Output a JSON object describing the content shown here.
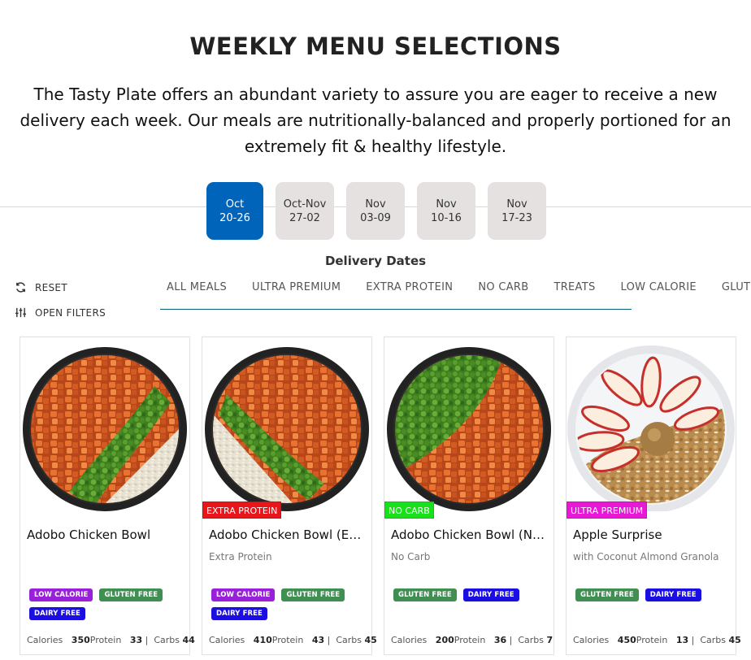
{
  "header": {
    "title": "WEEKLY MENU SELECTIONS",
    "intro": "The Tasty Plate offers an abundant variety to assure you are eager to receive a new delivery each week. Our meals are nutritionally-balanced and properly portioned for an extremely fit & healthy lifestyle."
  },
  "dates": [
    {
      "month": "Oct",
      "range": "20-26",
      "active": true
    },
    {
      "month": "Oct-Nov",
      "range": "27-02",
      "active": false
    },
    {
      "month": "Nov",
      "range": "03-09",
      "active": false
    },
    {
      "month": "Nov",
      "range": "10-16",
      "active": false
    },
    {
      "month": "Nov",
      "range": "17-23",
      "active": false
    }
  ],
  "dates_caption": "Delivery Dates",
  "controls": {
    "reset_label": "RESET",
    "filters_label": "OPEN FILTERS",
    "reset_icon": "refresh-icon",
    "filters_icon": "sliders-icon"
  },
  "filter_tabs": [
    "ALL MEALS",
    "ULTRA PREMIUM",
    "EXTRA PROTEIN",
    "NO CARB",
    "TREATS",
    "LOW CALORIE",
    "GLUT"
  ],
  "tag_colors": {
    "LOW CALORIE": "#9a1fd8",
    "GLUTEN FREE": "#3f8f52",
    "DAIRY FREE": "#1a0ee0",
    "EXTRA PROTEIN": "#e8161b",
    "NO CARB": "#19e01a",
    "ULTRA PREMIUM": "#e719d6"
  },
  "meals": [
    {
      "name": "Adobo Chicken Bowl",
      "badge": "",
      "subtitle": "",
      "tags": [
        "LOW CALORIE",
        "GLUTEN FREE",
        "DAIRY FREE"
      ],
      "stats": {
        "calories_label": "Calories",
        "calories": "350",
        "protein_label": "Protein",
        "protein": "33",
        "carbs_label": "Carbs",
        "carbs": "44"
      }
    },
    {
      "name": "Adobo Chicken Bowl (Ext...",
      "badge": "EXTRA PROTEIN",
      "subtitle": "Extra Protein",
      "tags": [
        "LOW CALORIE",
        "GLUTEN FREE",
        "DAIRY FREE"
      ],
      "stats": {
        "calories_label": "Calories",
        "calories": "410",
        "protein_label": "Protein",
        "protein": "43",
        "carbs_label": "Carbs",
        "carbs": "45"
      }
    },
    {
      "name": "Adobo Chicken Bowl (No...",
      "badge": "NO CARB",
      "subtitle": "No Carb",
      "tags": [
        "GLUTEN FREE",
        "DAIRY FREE"
      ],
      "stats": {
        "calories_label": "Calories",
        "calories": "200",
        "protein_label": "Protein",
        "protein": "36",
        "carbs_label": "Carbs",
        "carbs": "7"
      }
    },
    {
      "name": "Apple Surprise",
      "badge": "ULTRA PREMIUM",
      "subtitle": "with Coconut Almond Granola",
      "tags": [
        "GLUTEN FREE",
        "DAIRY FREE"
      ],
      "stats": {
        "calories_label": "Calories",
        "calories": "450",
        "protein_label": "Protein",
        "protein": "13",
        "carbs_label": "Carbs",
        "carbs": "45"
      }
    }
  ]
}
